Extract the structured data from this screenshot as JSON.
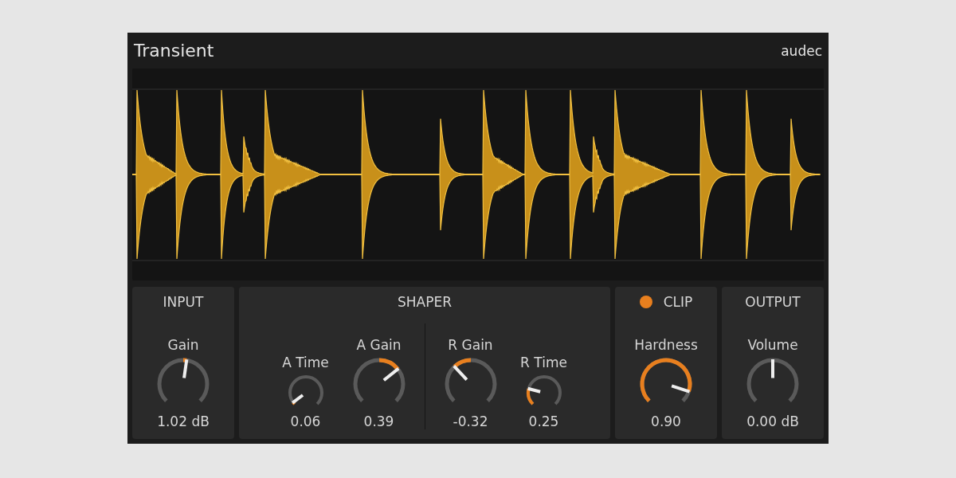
{
  "plugin": {
    "title": "Transient",
    "brand": "audec"
  },
  "sections": [
    {
      "title": "INPUT",
      "groups": [
        [
          {
            "label": "Gain",
            "value": "1.02 dB",
            "level": 0.53,
            "kind": "gain"
          }
        ]
      ]
    },
    {
      "title": "SHAPER",
      "groups": [
        [
          {
            "label": "A Time",
            "value": "0.06",
            "level": 0.03,
            "kind": "time"
          },
          {
            "label": "A Gain",
            "value": "0.39",
            "level": 0.69,
            "kind": "gain"
          }
        ],
        [
          {
            "label": "R Gain",
            "value": "-0.32",
            "level": 0.34,
            "kind": "gain"
          },
          {
            "label": "R Time",
            "value": "0.25",
            "level": 0.22,
            "kind": "time"
          }
        ]
      ]
    },
    {
      "title": "CLIP",
      "indicator": {
        "on": true
      },
      "groups": [
        [
          {
            "label": "Hardness",
            "value": "0.90",
            "level": 0.9,
            "kind": "amount"
          }
        ]
      ]
    },
    {
      "title": "OUTPUT",
      "groups": [
        [
          {
            "label": "Volume",
            "value": "0.00 dB",
            "level": 0.5,
            "kind": "gain"
          }
        ]
      ]
    }
  ]
}
